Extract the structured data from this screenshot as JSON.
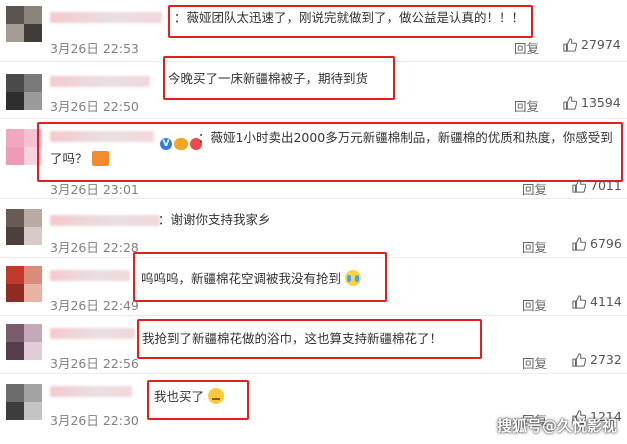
{
  "ui": {
    "reply_label": "回复",
    "highlight_color": "#e02020",
    "icons": {
      "like": "thumbs-up-icon",
      "verified": "verified-icon"
    }
  },
  "comments": [
    {
      "text": "：薇娅团队太迅速了，刚说完就做到了，做公益是认真的！！！",
      "time": "3月26日 22:53",
      "likes": "27974",
      "emoji": null
    },
    {
      "text": "今晚买了一床新疆棉被子，期待到货",
      "time": "3月26日 22:50",
      "likes": "13594",
      "emoji": null
    },
    {
      "text": "：薇娅1小时卖出2000多万元新疆棉制品，新疆棉的优质和热度，你感受到了吗？",
      "time": "3月26日 23:01",
      "likes": "7011",
      "emoji": "gift-icon"
    },
    {
      "text": "：谢谢你支持我家乡",
      "time": "3月26日 22:28",
      "likes": "6796",
      "emoji": null
    },
    {
      "text": "呜呜呜，新疆棉花空调被我没有抢到",
      "time": "3月26日 22:49",
      "likes": "4114",
      "emoji": "crying-face-icon"
    },
    {
      "text": "我抢到了新疆棉花做的浴巾，这也算支持新疆棉花了！",
      "time": "3月26日 22:56",
      "likes": "2732",
      "emoji": null
    },
    {
      "text": "我也买了",
      "time": "3月26日 22:30",
      "likes": "1214",
      "emoji": "thinking-face-icon"
    }
  ],
  "watermark": "搜狐号@久悦影视"
}
